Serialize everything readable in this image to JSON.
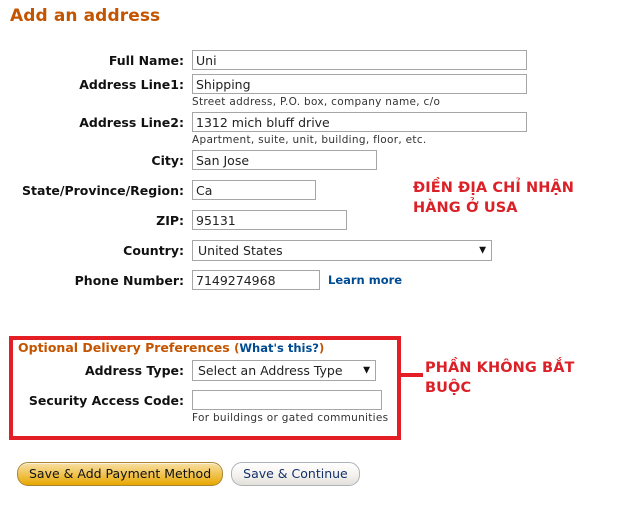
{
  "page": {
    "title": "Add an address"
  },
  "fields": {
    "full_name": {
      "label": "Full Name:",
      "value": "Uni",
      "placeholder": ""
    },
    "address_line1": {
      "label": "Address Line1:",
      "value": "Shipping",
      "placeholder": "",
      "hint": "Street address, P.O. box, company name, c/o"
    },
    "address_line2": {
      "label": "Address Line2:",
      "value": "1312 mich bluff drive",
      "placeholder": "",
      "hint": "Apartment, suite, unit, building, floor, etc."
    },
    "city": {
      "label": "City:",
      "value": "San Jose",
      "placeholder": ""
    },
    "state": {
      "label": "State/Province/Region:",
      "value": "Ca",
      "placeholder": ""
    },
    "zip": {
      "label": "ZIP:",
      "value": "95131",
      "placeholder": ""
    },
    "country": {
      "label": "Country:",
      "selected": "United States",
      "caret": "▼"
    },
    "phone": {
      "label": "Phone Number:",
      "value": "7149274968",
      "placeholder": "",
      "link": "Learn more"
    }
  },
  "optional": {
    "heading": "Optional Delivery Preferences",
    "whats_this_open": "(",
    "whats_this_link": "What's this?",
    "whats_this_close": ")",
    "address_type": {
      "label": "Address Type:",
      "selected": "Select an Address Type",
      "caret": "▼"
    },
    "security_access_code": {
      "label": "Security Access Code:",
      "value": "",
      "placeholder": "",
      "hint": "For buildings or gated communities"
    }
  },
  "buttons": {
    "primary": "Save & Add Payment Method",
    "secondary": "Save & Continue"
  },
  "annotations": {
    "top": "ĐIỀN ĐỊA CHỈ NHẬN\nHÀNG Ở USA",
    "bottom": "PHẦN KHÔNG BẮT\nBUỘC",
    "color": "#DB2027"
  }
}
